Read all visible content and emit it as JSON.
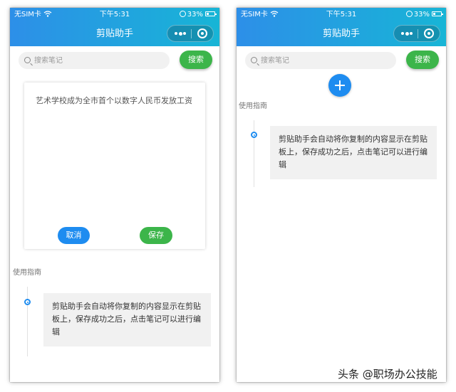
{
  "status_bar": {
    "carrier": "无SIM卡",
    "time": "下午5:31",
    "battery": "33%"
  },
  "app": {
    "title": "剪贴助手"
  },
  "search": {
    "placeholder": "搜索笔记",
    "button_label": "搜索"
  },
  "editor": {
    "text": "艺术学校成为全市首个以数字人民币发放工资",
    "cancel_label": "取消",
    "save_label": "保存"
  },
  "guide": {
    "heading": "使用指南",
    "text": "剪贴助手会自动将你复制的内容显示在剪贴板上，保存成功之后，点击笔记可以进行编辑"
  },
  "watermark": {
    "text": "头条 @职场办公技能"
  },
  "colors": {
    "primary_blue": "#1e8cf0",
    "green": "#3cb54a",
    "header_gradient_start": "#2d8fe8",
    "header_gradient_end": "#17b5d6"
  }
}
